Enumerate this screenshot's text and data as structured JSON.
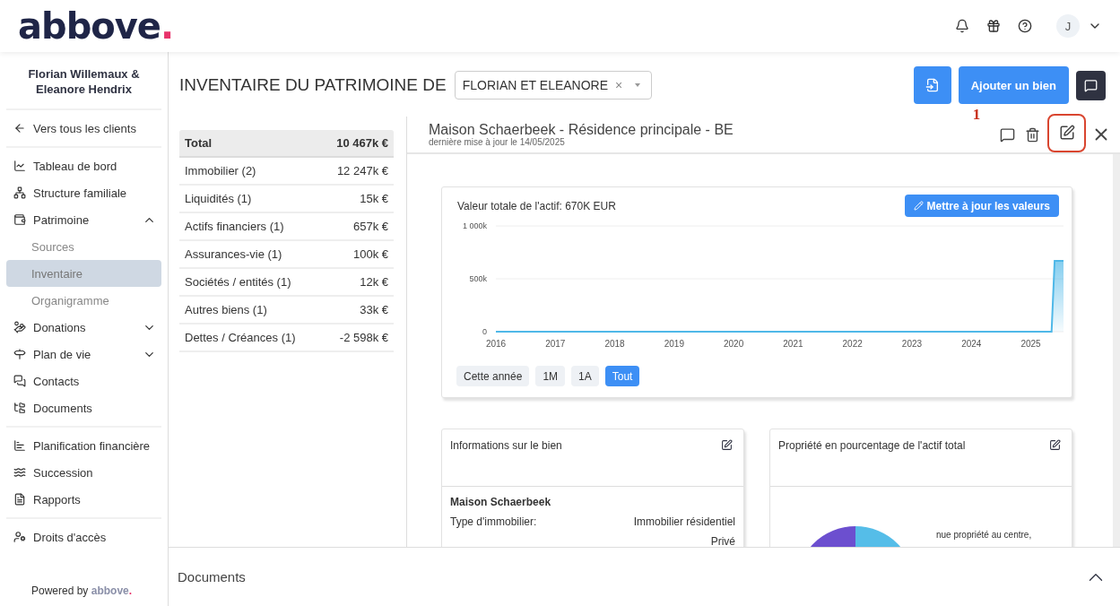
{
  "header": {
    "logo": {
      "name": "abbove",
      "mark": "."
    },
    "avatar": "J"
  },
  "sidebar": {
    "client_name": "Florian Willemaux & Eleanore Hendrix",
    "back_link": "Vers tous les clients",
    "groups": [
      [
        {
          "label": "Tableau de bord",
          "selected": false
        },
        {
          "label": "Structure familiale",
          "selected": false
        },
        {
          "label": "Patrimoine",
          "selected": false,
          "expanded": true,
          "children": [
            {
              "label": "Sources",
              "selected": false
            },
            {
              "label": "Inventaire",
              "selected": true
            },
            {
              "label": "Organigramme",
              "selected": false
            }
          ]
        },
        {
          "label": "Donations",
          "selected": false,
          "expanded": false
        },
        {
          "label": "Plan de vie",
          "selected": false,
          "expanded": false
        },
        {
          "label": "Contacts",
          "selected": false
        },
        {
          "label": "Documents",
          "selected": false
        }
      ],
      [
        {
          "label": "Planification financière",
          "selected": false
        },
        {
          "label": "Succession",
          "selected": false
        },
        {
          "label": "Rapports",
          "selected": false
        }
      ],
      [
        {
          "label": "Droits d'accès",
          "selected": false
        }
      ]
    ],
    "footer": {
      "prefix": "Powered by",
      "brand": "abbove",
      "mark": "."
    }
  },
  "page": {
    "title": "INVENTAIRE DU PATRIMOINE DE",
    "client_select": {
      "value": "FLORIAN ET ELEANORE",
      "clear": "×"
    },
    "add_button": "Ajouter un bien",
    "annotation": "1"
  },
  "summary": {
    "total": {
      "label": "Total",
      "value": "10 467k €"
    },
    "rows": [
      {
        "label": "Immobilier (2)",
        "value": "12 247k €"
      },
      {
        "label": "Liquidités (1)",
        "value": "15k €"
      },
      {
        "label": "Actifs financiers (1)",
        "value": "657k €"
      },
      {
        "label": "Assurances-vie (1)",
        "value": "100k €"
      },
      {
        "label": "Sociétés / entités (1)",
        "value": "12k €"
      },
      {
        "label": "Autres biens (1)",
        "value": "33k €"
      },
      {
        "label": "Dettes / Créances (1)",
        "value": "-2 598k €"
      }
    ]
  },
  "detail": {
    "title": "Maison Schaerbeek - Résidence principale - BE",
    "subtitle": "dernière mise à jour le 14/05/2025",
    "edit_highlighted": true,
    "value_card": {
      "title": "Valeur totale de l'actif: 670K EUR",
      "update_button": "Mettre à jour les valeurs",
      "chart_data": {
        "type": "area",
        "x": [
          2016,
          2017,
          2018,
          2019,
          2020,
          2021,
          2022,
          2023,
          2024,
          2025,
          2025.35,
          2025.4,
          2025.55
        ],
        "series": [
          {
            "color": "#4fb8e8",
            "values": [
              0,
              0,
              0,
              0,
              0,
              0,
              0,
              0,
              0,
              0,
              0,
              670,
              670
            ]
          }
        ],
        "xlim": [
          2016,
          2025.55
        ],
        "ylim": [
          0,
          1000
        ],
        "xticks": [
          2016,
          2017,
          2018,
          2019,
          2020,
          2021,
          2022,
          2023,
          2024,
          2025
        ],
        "yticks": [
          {
            "value": 0,
            "label": "0"
          },
          {
            "value": 500,
            "label": "500k"
          },
          {
            "value": 1000,
            "label": "1 000k"
          }
        ]
      },
      "ranges": [
        {
          "label": "Cette année",
          "selected": false
        },
        {
          "label": "1M",
          "selected": false
        },
        {
          "label": "1A",
          "selected": false
        },
        {
          "label": "Tout",
          "selected": true
        }
      ]
    },
    "info_card": {
      "title": "Informations sur le bien",
      "name": "Maison Schaerbeek",
      "fields": [
        {
          "label": "Type d'immobilier:",
          "value": "Immobilier résidentiel"
        },
        {
          "value": "Privé"
        }
      ]
    },
    "ownership_card": {
      "title": "Propriété en pourcentage de l'actif total",
      "legend": "nue propriété au centre,"
    }
  },
  "documents_bar": {
    "title": "Documents",
    "expanded": false
  }
}
